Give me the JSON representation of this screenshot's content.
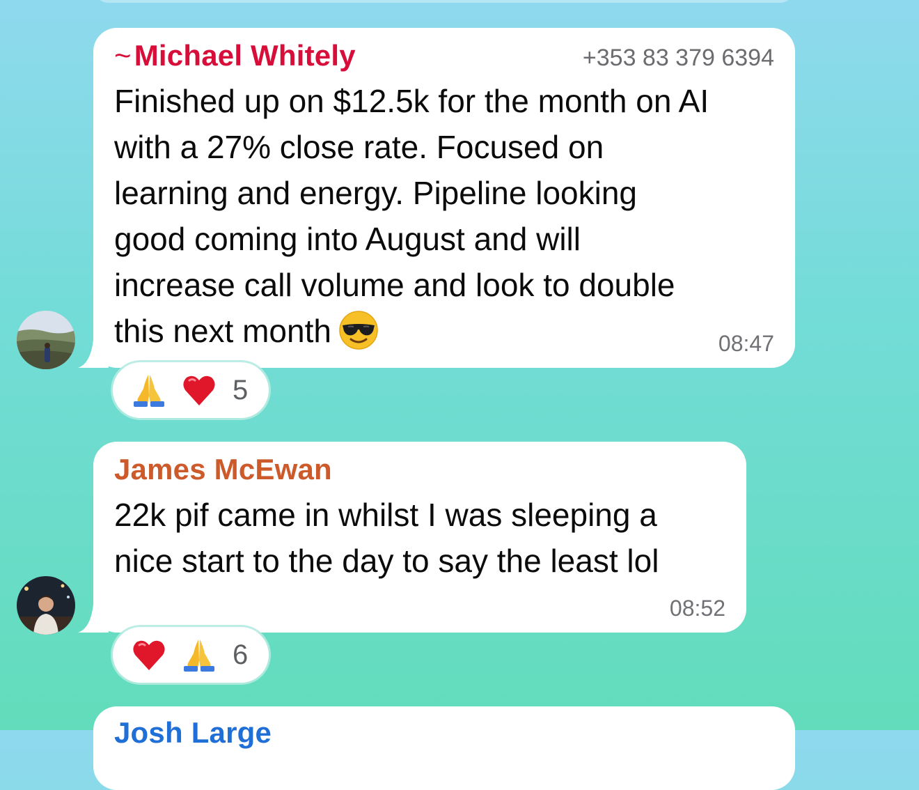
{
  "messages": [
    {
      "sender_prefix": "~",
      "sender": "Michael Whitely",
      "phone": "+353 83 379 6394",
      "text": "Finished up on $12.5k for the month on AI\nwith a 27% close rate. Focused on\nlearning and energy. Pipeline looking\ngood coming into August and will\nincrease call volume and look to double\nthis next month",
      "emoji": "smiling-face-with-sunglasses-icon",
      "time": "08:47",
      "reactions": {
        "icons": [
          "folded-hands-icon",
          "red-heart-icon"
        ],
        "count": "5"
      }
    },
    {
      "sender": "James McEwan",
      "text": "22k pif came in whilst I was sleeping a\nnice start to the day to say the least lol",
      "time": "08:52",
      "reactions": {
        "icons": [
          "red-heart-icon",
          "folded-hands-icon"
        ],
        "count": "6"
      }
    },
    {
      "sender": "Josh Large"
    }
  ],
  "colors": {
    "sender_michael": "#d70e3a",
    "sender_james": "#cd5a2a",
    "sender_josh": "#1f6fd6",
    "bubble": "#ffffff"
  }
}
